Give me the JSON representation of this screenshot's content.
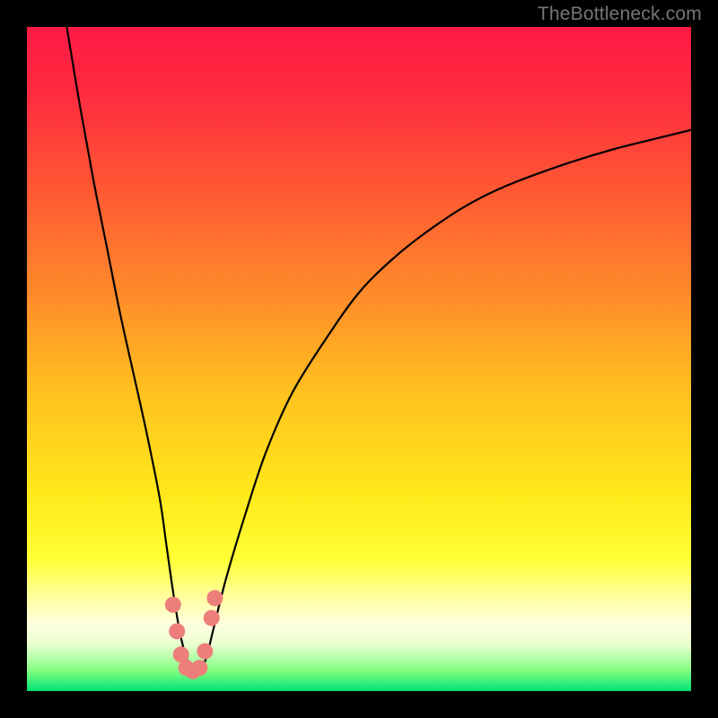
{
  "watermark": "TheBottleneck.com",
  "chart_data": {
    "type": "line",
    "title": "",
    "xlabel": "",
    "ylabel": "",
    "xlim": [
      0,
      100
    ],
    "ylim": [
      0,
      100
    ],
    "gradient_stops": [
      {
        "offset": 0.0,
        "color": "#ff1a45"
      },
      {
        "offset": 0.1,
        "color": "#ff2b3f"
      },
      {
        "offset": 0.25,
        "color": "#ff5a33"
      },
      {
        "offset": 0.4,
        "color": "#ff8a2a"
      },
      {
        "offset": 0.55,
        "color": "#ffc11f"
      },
      {
        "offset": 0.7,
        "color": "#ffe81a"
      },
      {
        "offset": 0.8,
        "color": "#ffff33"
      },
      {
        "offset": 0.86,
        "color": "#ffffa0"
      },
      {
        "offset": 0.9,
        "color": "#ffffe0"
      },
      {
        "offset": 0.93,
        "color": "#e8ffd0"
      },
      {
        "offset": 0.97,
        "color": "#80ff80"
      },
      {
        "offset": 1.0,
        "color": "#00e076"
      }
    ],
    "series": [
      {
        "name": "bottleneck-curve",
        "x": [
          6,
          8,
          10,
          12,
          14,
          16,
          18,
          20,
          21,
          22,
          23,
          24,
          25,
          26,
          27,
          28,
          30,
          33,
          36,
          40,
          45,
          50,
          55,
          60,
          66,
          72,
          80,
          88,
          96,
          100
        ],
        "y": [
          100,
          88,
          77,
          67,
          57,
          48,
          39,
          29,
          22,
          15,
          9,
          5,
          3,
          3,
          5,
          9,
          17,
          27,
          36,
          45,
          53,
          60,
          65,
          69,
          73,
          76,
          79,
          81.5,
          83.5,
          84.5
        ]
      }
    ],
    "markers": {
      "name": "bottleneck-band",
      "color": "#ed7f7b",
      "points": [
        {
          "x": 22.0,
          "y": 13
        },
        {
          "x": 22.6,
          "y": 9
        },
        {
          "x": 23.2,
          "y": 5.5
        },
        {
          "x": 24.0,
          "y": 3.5
        },
        {
          "x": 25.0,
          "y": 3.0
        },
        {
          "x": 26.0,
          "y": 3.5
        },
        {
          "x": 26.8,
          "y": 6.0
        },
        {
          "x": 27.8,
          "y": 11
        },
        {
          "x": 28.3,
          "y": 14
        }
      ]
    }
  }
}
